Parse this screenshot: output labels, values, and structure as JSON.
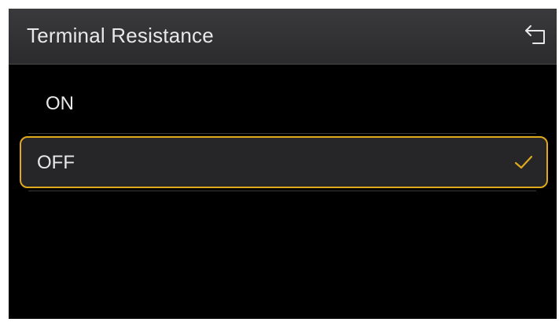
{
  "header": {
    "title": "Terminal Resistance",
    "back_icon": "back-arrow-icon"
  },
  "options": [
    {
      "label": "ON",
      "selected": false
    },
    {
      "label": "OFF",
      "selected": true
    }
  ],
  "colors": {
    "accent": "#e0a81c",
    "background": "#000000",
    "header_bg": "#333335",
    "text": "#e8e8e8"
  }
}
